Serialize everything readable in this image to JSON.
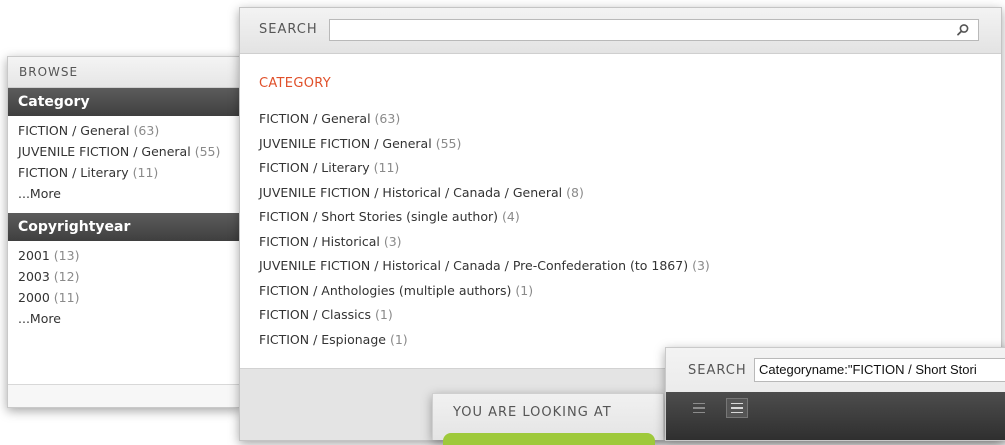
{
  "browse": {
    "title": "BROWSE",
    "facets": [
      {
        "header": "Category",
        "items": [
          {
            "label": "FICTION / General",
            "count": "(63)"
          },
          {
            "label": "JUVENILE FICTION / General",
            "count": "(55)"
          },
          {
            "label": "FICTION / Literary",
            "count": "(11)"
          }
        ],
        "more": "...More"
      },
      {
        "header": "Copyrightyear",
        "items": [
          {
            "label": "2001",
            "count": "(13)"
          },
          {
            "label": "2003",
            "count": "(12)"
          },
          {
            "label": "2000",
            "count": "(11)"
          }
        ],
        "more": "...More"
      }
    ]
  },
  "main": {
    "search_label": "SEARCH",
    "search_value": "",
    "search_icon": "search-icon",
    "category_title": "CATEGORY",
    "results": [
      {
        "label": "FICTION / General",
        "count": "(63)"
      },
      {
        "label": "JUVENILE FICTION / General",
        "count": "(55)"
      },
      {
        "label": "FICTION / Literary",
        "count": "(11)"
      },
      {
        "label": "JUVENILE FICTION / Historical / Canada / General",
        "count": "(8)"
      },
      {
        "label": "FICTION / Short Stories (single author)",
        "count": "(4)"
      },
      {
        "label": "FICTION / Historical",
        "count": "(3)"
      },
      {
        "label": "JUVENILE FICTION / Historical / Canada / Pre-Confederation (to 1867)",
        "count": "(3)"
      },
      {
        "label": "FICTION / Anthologies (multiple authors)",
        "count": "(1)"
      },
      {
        "label": "FICTION / Classics",
        "count": "(1)"
      },
      {
        "label": "FICTION / Espionage",
        "count": "(1)"
      }
    ]
  },
  "looking": {
    "title": "YOU ARE LOOKING AT",
    "accent": "#9ec93a"
  },
  "search2": {
    "label": "SEARCH",
    "value": "Categoryname:\"FICTION / Short Stori",
    "view_buttons": [
      "list-view-icon",
      "detail-view-icon"
    ]
  },
  "colors": {
    "category_accent": "#e0502a",
    "facet_header": "#4a4a4a",
    "count_text": "#8a8a8a"
  }
}
